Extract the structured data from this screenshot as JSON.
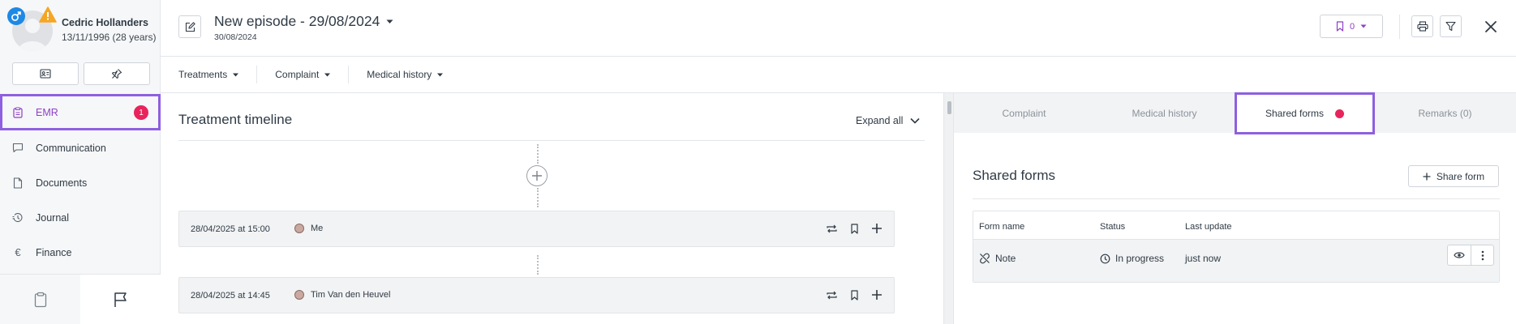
{
  "patient": {
    "name": "Cedric Hollanders",
    "dob_age": "13/11/1996 (28 years)",
    "gender_icon": "male-icon",
    "warning_icon": "warning-icon"
  },
  "sidebar": {
    "items": [
      {
        "label": "EMR",
        "icon": "clipboard-icon",
        "badge": "1"
      },
      {
        "label": "Communication",
        "icon": "chat-icon"
      },
      {
        "label": "Documents",
        "icon": "document-icon"
      },
      {
        "label": "Journal",
        "icon": "history-icon"
      },
      {
        "label": "Finance",
        "icon": "euro-icon"
      }
    ]
  },
  "header": {
    "title": "New episode - 29/08/2024",
    "date": "30/08/2024",
    "bookmark_count": "0"
  },
  "subbar": {
    "items": [
      "Treatments",
      "Complaint",
      "Medical history"
    ]
  },
  "timeline": {
    "title": "Treatment timeline",
    "expand_label": "Expand all",
    "entries": [
      {
        "when": "28/04/2025 at 15:00",
        "who": "Me"
      },
      {
        "when": "28/04/2025 at 14:45",
        "who": "Tim Van den Heuvel"
      }
    ]
  },
  "right_panel": {
    "tabs": [
      "Complaint",
      "Medical history",
      "Shared forms",
      "Remarks (0)"
    ],
    "active_tab": "Shared forms",
    "section_title": "Shared forms",
    "share_button": "Share form",
    "table": {
      "headers": [
        "Form name",
        "Status",
        "Last update"
      ],
      "rows": [
        {
          "form_name": "Note",
          "status": "In progress",
          "last_update": "just now"
        }
      ]
    }
  },
  "colors": {
    "accent_purple": "#8e3fc6",
    "highlight_border": "#8e5fe0",
    "badge_red": "#e8245c",
    "gender_blue": "#1e88e5",
    "warning_orange": "#f5a623"
  }
}
